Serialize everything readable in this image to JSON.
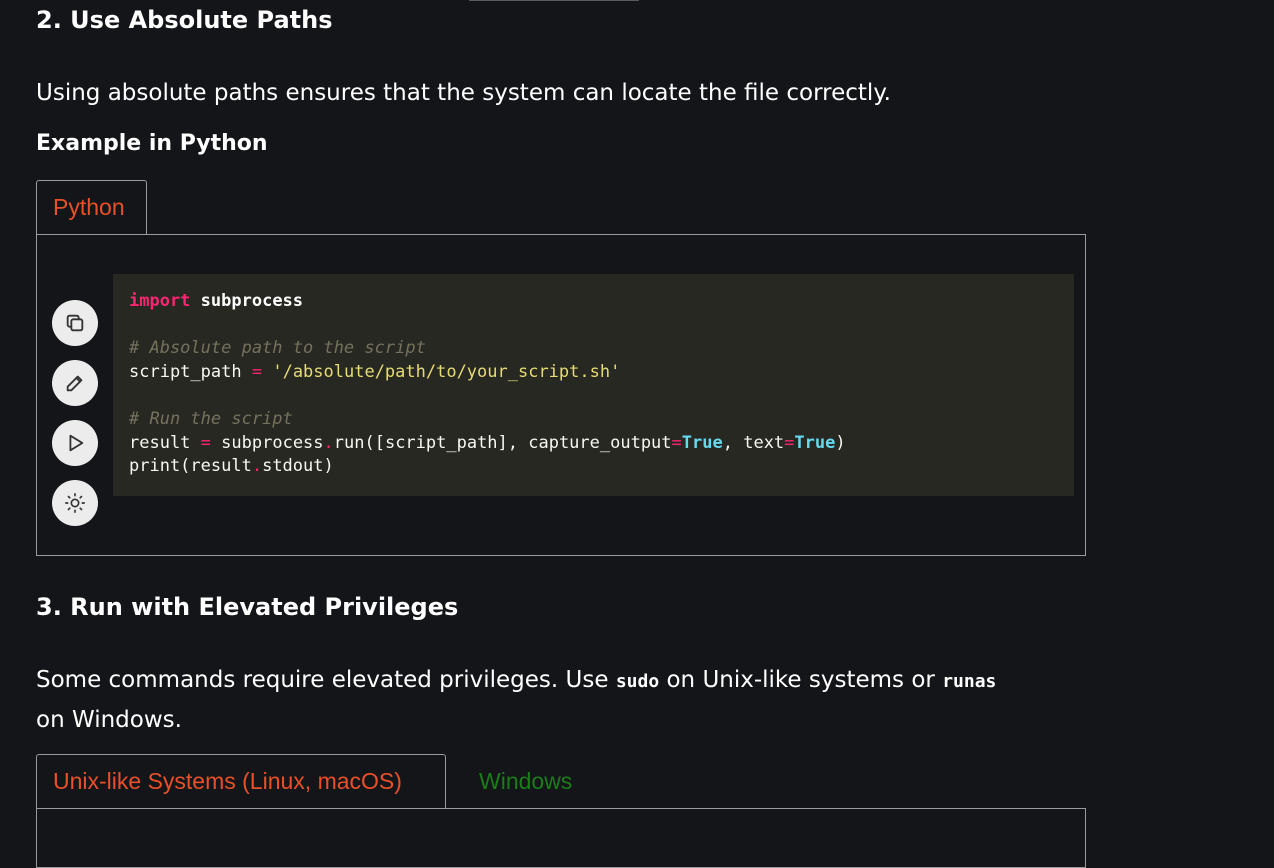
{
  "section2": {
    "heading": "2. Use Absolute Paths",
    "paragraph": "Using absolute paths ensures that the system can locate the file correctly.",
    "subheading": "Example in Python",
    "tab_label": "Python",
    "code": {
      "line1_kw": "import",
      "line1_mod": "subprocess",
      "line3_comment": "# Absolute path to the script",
      "line4_var": "script_path",
      "line4_op": "=",
      "line4_str": "'/absolute/path/to/your_script.sh'",
      "line6_comment": "# Run the script",
      "line7_a": "result",
      "line7_op": "=",
      "line7_b": "subprocess",
      "line7_dot": ".",
      "line7_c": "run([script_path], capture_output",
      "line7_eq1": "=",
      "line7_true1": "True",
      "line7_d": ", text",
      "line7_eq2": "=",
      "line7_true2": "True",
      "line7_e": ")",
      "line8_a": "print(result",
      "line8_dot": ".",
      "line8_b": "stdout)"
    }
  },
  "toolbar": {
    "icons": [
      "copy-icon",
      "edit-icon",
      "play-icon",
      "theme-icon"
    ]
  },
  "section3": {
    "heading": "3. Run with Elevated Privileges",
    "paragraph_a": "Some commands require elevated privileges. Use ",
    "code_sudo": "sudo",
    "paragraph_b": " on Unix-like systems or ",
    "code_runas": "runas",
    "paragraph_c": " on Windows.",
    "tabs": [
      {
        "label": "Unix-like Systems (Linux, macOS)",
        "active": true
      },
      {
        "label": "Windows",
        "active": false
      }
    ]
  },
  "colors": {
    "background": "#141519",
    "active_tab": "#e8502a",
    "inactive_tab": "#1a7d1a",
    "code_bg": "#272822"
  }
}
